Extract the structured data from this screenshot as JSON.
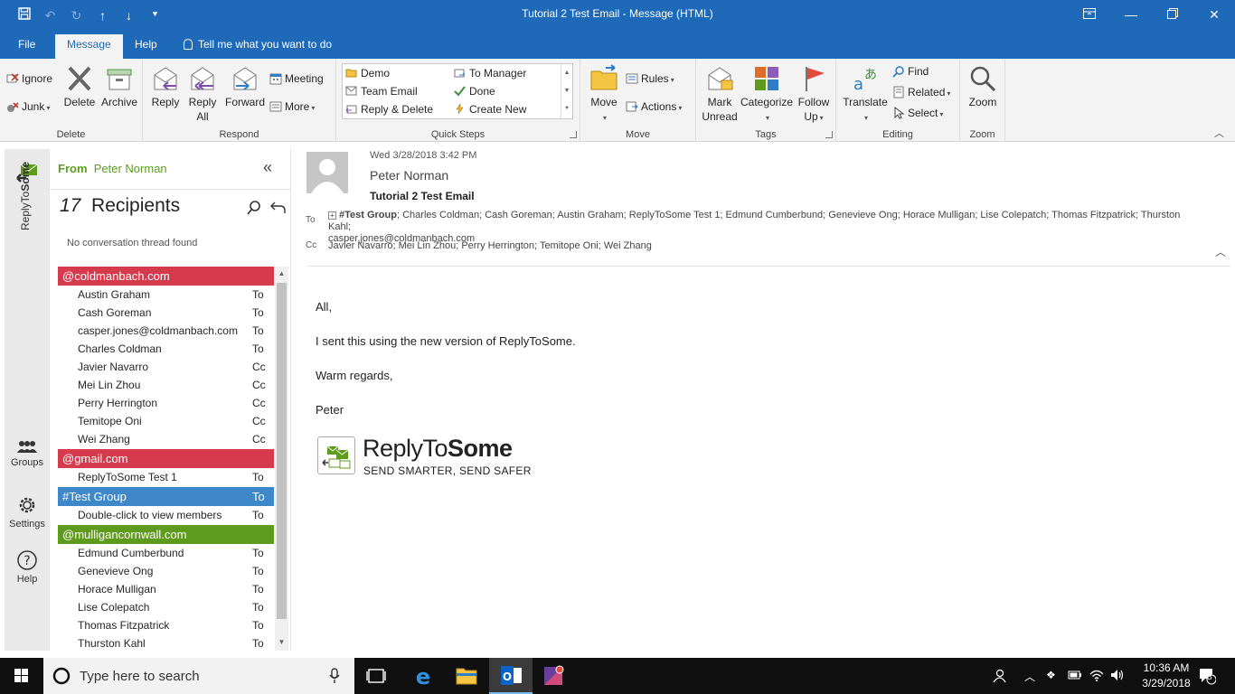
{
  "window": {
    "title": "Tutorial 2 Test Email  -  Message (HTML)"
  },
  "menu_tabs": [
    "File",
    "Message",
    "Help",
    "Tell me what you want to do"
  ],
  "ribbon": {
    "delete_group": {
      "label": "Delete",
      "ignore": "Ignore",
      "junk": "Junk",
      "delete": "Delete",
      "archive": "Archive"
    },
    "respond_group": {
      "label": "Respond",
      "reply": "Reply",
      "reply_all_1": "Reply",
      "reply_all_2": "All",
      "forward": "Forward",
      "meeting": "Meeting",
      "more": "More"
    },
    "quick_steps": {
      "label": "Quick Steps",
      "items": [
        "Demo",
        "To Manager",
        "Team Email",
        "Done",
        "Reply & Delete",
        "Create New"
      ]
    },
    "move_group": {
      "label": "Move",
      "move": "Move",
      "rules": "Rules",
      "actions": "Actions"
    },
    "tags_group": {
      "label": "Tags",
      "mark_unread_1": "Mark",
      "mark_unread_2": "Unread",
      "categorize": "Categorize",
      "follow_up_1": "Follow",
      "follow_up_2": "Up"
    },
    "editing_group": {
      "label": "Editing",
      "translate": "Translate",
      "find": "Find",
      "related": "Related",
      "select": "Select"
    },
    "zoom_group": {
      "label": "Zoom",
      "zoom": "Zoom"
    }
  },
  "addin_rail": {
    "title_part1": "ReplyTo",
    "title_part2": "Some",
    "groups": "Groups",
    "settings": "Settings",
    "help": "Help"
  },
  "recipients_pane": {
    "from_label": "From",
    "from_name": "Peter Norman",
    "count": "17",
    "count_label": "Recipients",
    "no_thread": "No conversation thread found",
    "groups": [
      {
        "header": "@coldmanbach.com",
        "color": "#d63b4d",
        "type": "",
        "rows": [
          {
            "name": "Austin Graham",
            "type": "To"
          },
          {
            "name": "Cash Goreman",
            "type": "To"
          },
          {
            "name": "casper.jones@coldmanbach.com",
            "type": "To"
          },
          {
            "name": "Charles Coldman",
            "type": "To"
          },
          {
            "name": "Javier Navarro",
            "type": "Cc"
          },
          {
            "name": "Mei Lin Zhou",
            "type": "Cc"
          },
          {
            "name": "Perry Herrington",
            "type": "Cc"
          },
          {
            "name": "Temitope Oni",
            "type": "Cc"
          },
          {
            "name": "Wei Zhang",
            "type": "Cc"
          }
        ]
      },
      {
        "header": "@gmail.com",
        "color": "#d63b4d",
        "type": "",
        "rows": [
          {
            "name": "ReplyToSome Test 1",
            "type": "To"
          }
        ]
      },
      {
        "header": "#Test Group",
        "color": "#3e88c9",
        "type": "To",
        "rows": [
          {
            "name": "Double-click to view members",
            "type": "To"
          }
        ]
      },
      {
        "header": "@mulligancornwall.com",
        "color": "#5e9b1d",
        "type": "",
        "rows": [
          {
            "name": "Edmund Cumberbund",
            "type": "To"
          },
          {
            "name": "Genevieve Ong",
            "type": "To"
          },
          {
            "name": "Horace Mulligan",
            "type": "To"
          },
          {
            "name": "Lise Colepatch",
            "type": "To"
          },
          {
            "name": "Thomas Fitzpatrick",
            "type": "To"
          },
          {
            "name": "Thurston Kahl",
            "type": "To"
          }
        ]
      }
    ]
  },
  "message": {
    "date": "Wed 3/28/2018 3:42 PM",
    "from": "Peter Norman",
    "subject": "Tutorial 2 Test Email",
    "to_label": "To",
    "to_group": "#Test Group",
    "to_line1": "; Charles Coldman; Cash Goreman; Austin Graham; ReplyToSome Test 1; Edmund Cumberbund; Genevieve Ong; Horace Mulligan; Lise Colepatch; Thomas Fitzpatrick; Thurston Kahl;",
    "to_line2": "casper.jones@coldmanbach.com",
    "cc_label": "Cc",
    "cc": "Javier Navarro; Mei Lin Zhou; Perry Herrington; Temitope Oni; Wei Zhang",
    "body": [
      "All,",
      "I sent this using the new version of ReplyToSome.",
      "Warm regards,",
      "Peter"
    ],
    "signature": {
      "brand_part1": "ReplyTo",
      "brand_part2": "Some",
      "tagline": "SEND SMARTER, SEND SAFER"
    }
  },
  "taskbar": {
    "search_placeholder": "Type here to search",
    "time": "10:36 AM",
    "date": "3/29/2018",
    "notifications": "8"
  },
  "colors": {
    "accent": "#1f6ab8",
    "from_green": "#5b9e1f",
    "red_group": "#d63b4d",
    "blue_group": "#3e88c9",
    "green_group": "#5e9b1d"
  }
}
